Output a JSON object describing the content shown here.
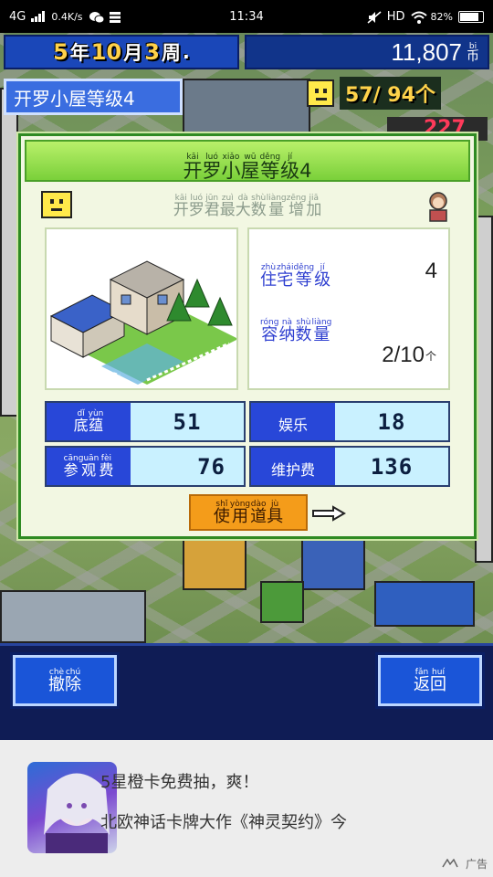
{
  "status_bar": {
    "network": "4G",
    "speed": "0.4K/s",
    "time": "11:34",
    "hd": "HD",
    "battery": "82%"
  },
  "game_bar": {
    "date_parts": [
      {
        "text": "5",
        "unit": false
      },
      {
        "text": "年",
        "unit": true
      },
      {
        "text": "10",
        "unit": false
      },
      {
        "text": "月",
        "unit": true
      },
      {
        "text": "3",
        "unit": false
      },
      {
        "text": "周",
        "unit": true
      },
      {
        "text": ".",
        "unit": true
      }
    ],
    "money": "11,807",
    "currency_top": "bi",
    "currency": "币",
    "tag_name_hz": "开罗小屋等级4",
    "counter": "57/ 94个",
    "red_number": "227"
  },
  "dialog": {
    "title": {
      "pinyin": [
        "kāi",
        "luó",
        "xiǎo",
        "wū",
        "děng",
        "jí",
        ""
      ],
      "hanzi": [
        "开",
        "罗",
        "小",
        "屋",
        "等",
        "级",
        "4"
      ]
    },
    "effect": {
      "pinyin": [
        "kāi",
        "luó",
        "jūn",
        "zuì",
        "dà",
        "shù",
        "liàng",
        "zēng",
        "jiā"
      ],
      "hanzi": [
        "开",
        "罗",
        "君",
        "最",
        "大",
        "数",
        "量",
        "增",
        "加"
      ]
    },
    "info": {
      "level_label": {
        "pinyin": [
          "zhù",
          "zhái",
          "děng",
          "jí"
        ],
        "hanzi": [
          "住",
          "宅",
          "等",
          "级"
        ]
      },
      "level_value": "4",
      "capacity_label": {
        "pinyin": [
          "róng",
          "nà",
          "shù",
          "liàng"
        ],
        "hanzi": [
          "容",
          "纳",
          "数",
          "量"
        ]
      },
      "capacity_value": "2/10",
      "capacity_unit": "个"
    },
    "stats": [
      {
        "key_pinyin": [
          "dǐ",
          "yùn"
        ],
        "key_hanzi": [
          "底",
          "蕴"
        ],
        "value": "51"
      },
      {
        "key_pinyin": [
          "",
          ""
        ],
        "key_hanzi": [
          "娱",
          "乐"
        ],
        "value": "18"
      },
      {
        "key_pinyin": [
          "cān",
          "guān",
          "fèi"
        ],
        "key_hanzi": [
          "参",
          "观",
          "费"
        ],
        "value": "76"
      },
      {
        "key_pinyin": [
          "",
          "",
          ""
        ],
        "key_hanzi": [
          "维",
          "护",
          "费"
        ],
        "value": "136"
      }
    ],
    "use_item": {
      "pinyin": [
        "shǐ",
        "yòng",
        "dào",
        "jù"
      ],
      "hanzi": [
        "使",
        "用",
        "道",
        "具"
      ]
    }
  },
  "bottom": {
    "remove": {
      "pinyin": [
        "chè",
        "chú"
      ],
      "hanzi": [
        "撤",
        "除"
      ]
    },
    "back": {
      "pinyin": [
        "fǎn",
        "huí"
      ],
      "hanzi": [
        "返",
        "回"
      ]
    }
  },
  "ad": {
    "line1": "5星橙卡免费抽，爽！",
    "line2": "北欧神话卡牌大作《神灵契约》今",
    "line3": "",
    "label": "广告"
  }
}
